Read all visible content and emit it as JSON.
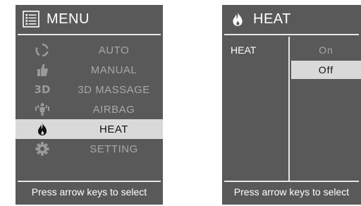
{
  "menu_screen": {
    "title": "MENU",
    "title_icon": "list-icon",
    "items": [
      {
        "label": "AUTO",
        "icon": "cycle-icon",
        "selected": false
      },
      {
        "label": "MANUAL",
        "icon": "thumb-icon",
        "selected": false
      },
      {
        "label": "3D MASSAGE",
        "icon": "3d-icon",
        "icon_text": "3D",
        "selected": false
      },
      {
        "label": "AIRBAG",
        "icon": "airbag-icon",
        "selected": false
      },
      {
        "label": "HEAT",
        "icon": "flame-icon",
        "selected": true
      },
      {
        "label": "SETTING",
        "icon": "gear-icon",
        "selected": false
      }
    ],
    "footer": "Press arrow keys to select"
  },
  "heat_screen": {
    "title": "HEAT",
    "title_icon": "flame-icon",
    "label": "HEAT",
    "options": [
      {
        "label": "On",
        "selected": false
      },
      {
        "label": "Off",
        "selected": true
      }
    ],
    "footer": "Press arrow keys to select"
  },
  "colors": {
    "screen_bg": "#595959",
    "selected_bg": "#d9d9d9",
    "text_white": "#ffffff",
    "text_dim": "#a8a8a8"
  }
}
